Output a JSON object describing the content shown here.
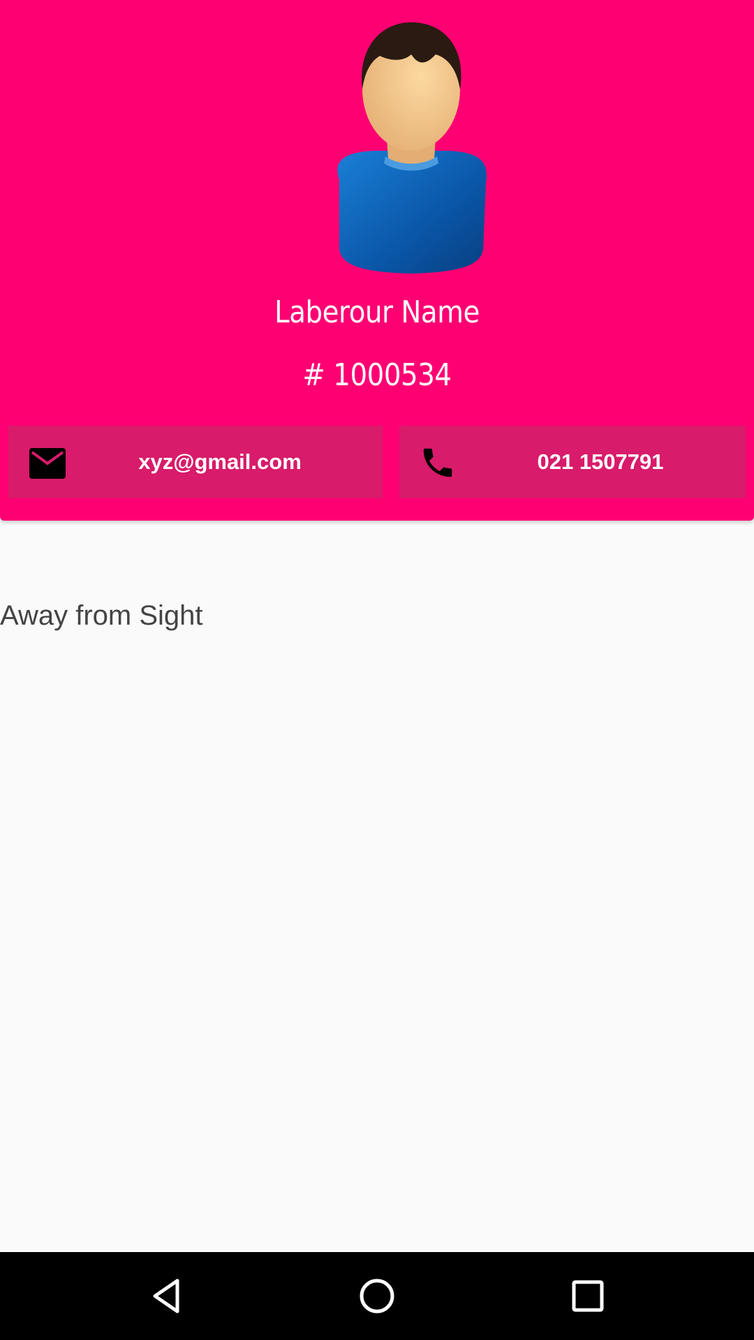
{
  "profile": {
    "name": "Laberour Name",
    "id": "# 1000534",
    "avatar_icon": "person-avatar-icon"
  },
  "contacts": {
    "email": {
      "icon": "mail-icon",
      "value": "xyz@gmail.com"
    },
    "phone": {
      "icon": "phone-icon",
      "value": "021 1507791"
    }
  },
  "content": {
    "status": "Away from Sight"
  },
  "navbar": {
    "back_icon": "back-triangle-icon",
    "home_icon": "home-circle-icon",
    "recent_icon": "recents-square-icon"
  },
  "colors": {
    "header_bg": "#ff0073",
    "contact_bg": "#d81b6a",
    "page_bg": "#fafafa"
  }
}
